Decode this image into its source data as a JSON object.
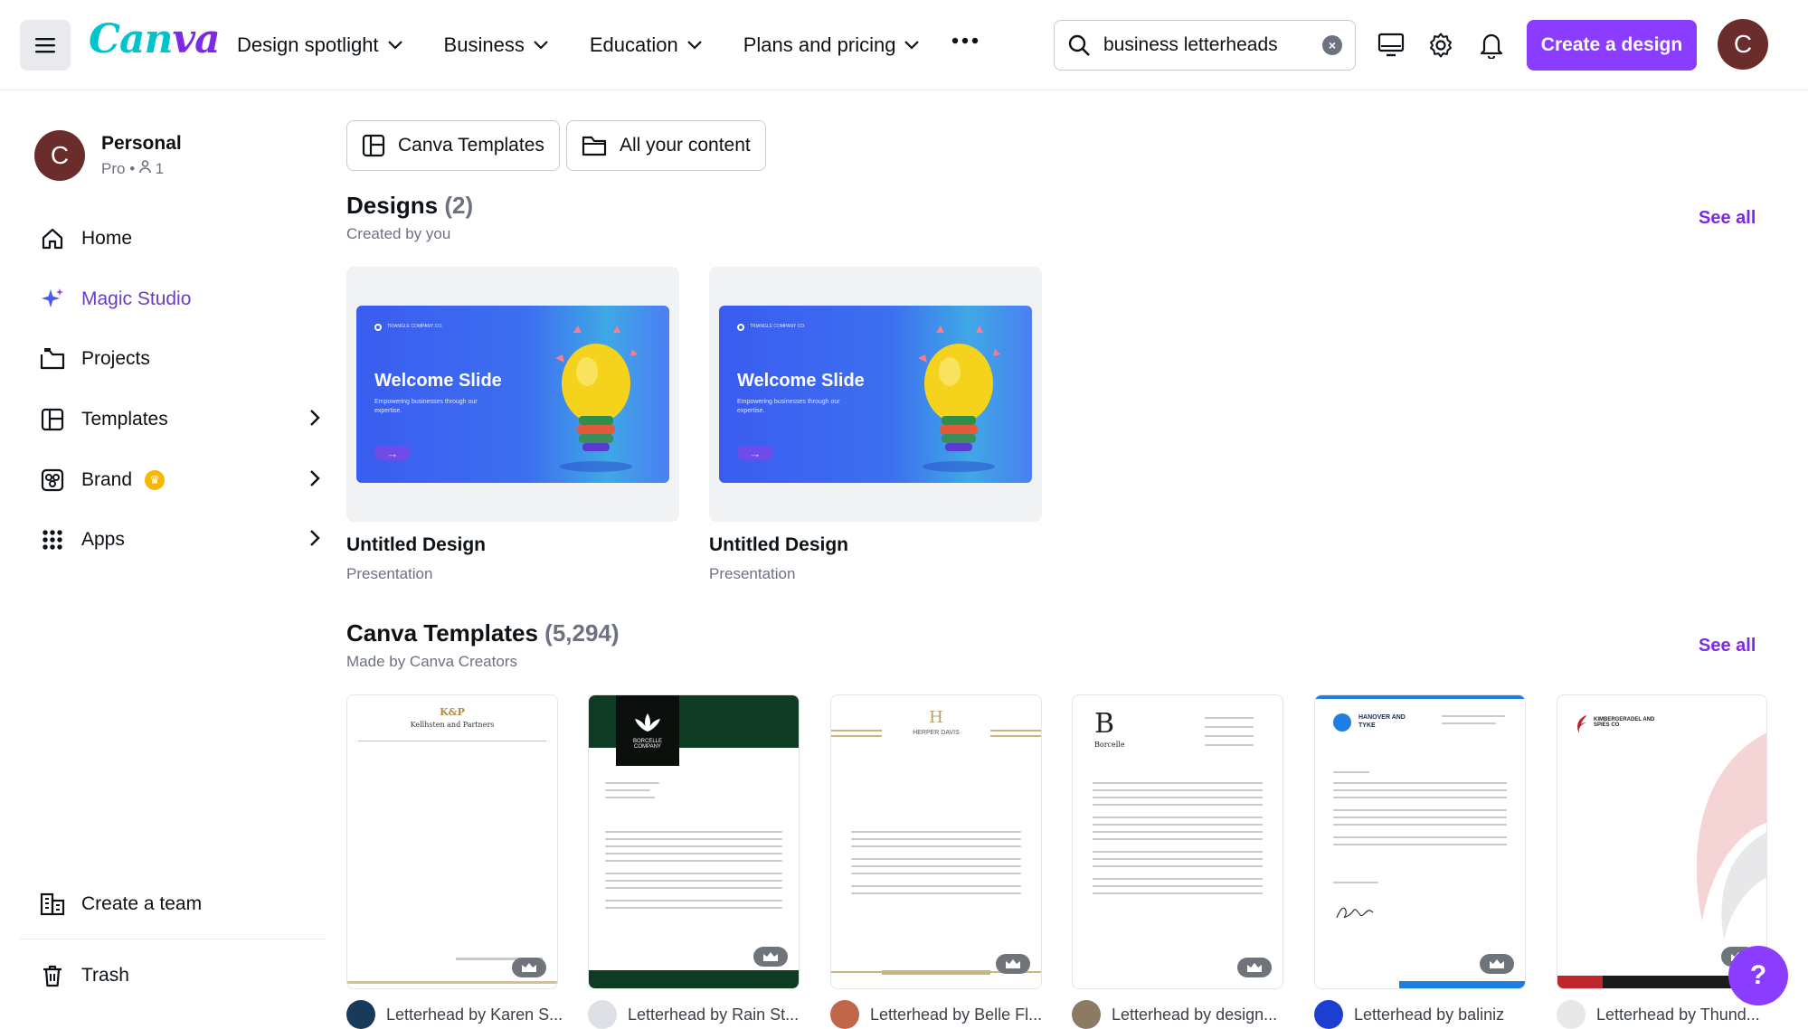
{
  "header": {
    "logo": "Canva",
    "nav": [
      {
        "label": "Design spotlight"
      },
      {
        "label": "Business"
      },
      {
        "label": "Education"
      },
      {
        "label": "Plans and pricing"
      }
    ],
    "search_value": "business letterheads",
    "create_label": "Create a design",
    "avatar_initial": "C"
  },
  "sidebar": {
    "account_name": "Personal",
    "account_plan": "Pro",
    "account_members": "1",
    "avatar_initial": "C",
    "items": [
      {
        "label": "Home"
      },
      {
        "label": "Magic Studio"
      },
      {
        "label": "Projects"
      },
      {
        "label": "Templates"
      },
      {
        "label": "Brand"
      },
      {
        "label": "Apps"
      }
    ],
    "create_team": "Create a team",
    "trash": "Trash"
  },
  "filters": {
    "canva_templates": "Canva Templates",
    "all_content": "All your content"
  },
  "designs": {
    "title": "Designs",
    "count": "(2)",
    "subtitle": "Created by you",
    "see_all": "See all",
    "items": [
      {
        "name": "Untitled Design",
        "type": "Presentation",
        "slide_title": "Welcome Slide",
        "slide_desc": "Empowering businesses through our expertise.",
        "slide_small": "TRIANGLE COMPANY CO."
      },
      {
        "name": "Untitled Design",
        "type": "Presentation",
        "slide_title": "Welcome Slide",
        "slide_desc": "Empowering businesses through our expertise.",
        "slide_small": "TRIANGLE COMPANY CO."
      }
    ]
  },
  "templates": {
    "title": "Canva Templates",
    "count": "(5,294)",
    "subtitle": "Made by Canva Creators",
    "see_all": "See all",
    "items": [
      {
        "label": "Letterhead by Karen S...",
        "heading": "Kellhsten and Partners",
        "avatar_color": "#1a3a5c"
      },
      {
        "label": "Letterhead by Rain St...",
        "heading": "BORCELLE COMPANY",
        "avatar_color": "#dde1e6"
      },
      {
        "label": "Letterhead by Belle Fl...",
        "heading": "HERPER DAVIS",
        "avatar_color": "#c0664a"
      },
      {
        "label": "Letterhead by design...",
        "heading": "Borcelle",
        "avatar_color": "#8d7a63"
      },
      {
        "label": "Letterhead by baliniz",
        "heading": "HANOVER AND TYKE",
        "avatar_color": "#1d3fd1"
      },
      {
        "label": "Letterhead by Thund...",
        "heading": "KIMBERGERADEL AND SPIES CO",
        "avatar_color": "#e8e8e8"
      }
    ]
  },
  "help_label": "?"
}
